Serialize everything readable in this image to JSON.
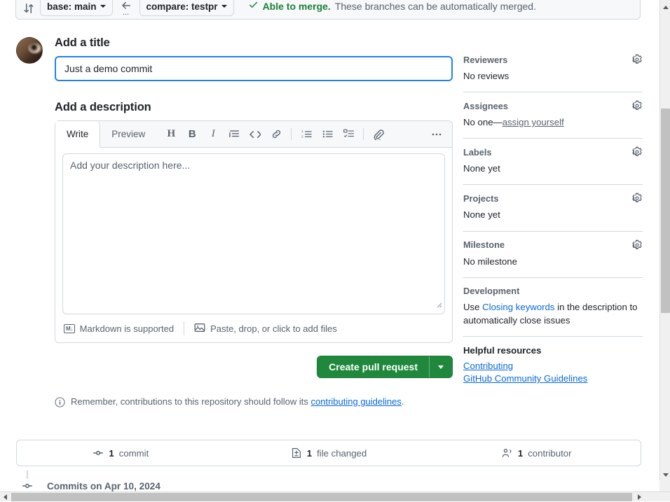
{
  "compare_bar": {
    "compare_icon": "branch-compare-icon",
    "base_label": "base: main",
    "arrow_icon": "arrow-left-icon",
    "arrow_dots": "...",
    "compare_label": "compare: testpr",
    "check_icon": "check-icon",
    "merge_status_strong": "Able to merge.",
    "merge_status_rest": "These branches can be automatically merged."
  },
  "form": {
    "title_heading": "Add a title",
    "title_value": "Just a demo commit",
    "title_placeholder": "Title",
    "description_heading": "Add a description",
    "description_value": "",
    "description_placeholder": "Add your description here...",
    "tabs": [
      {
        "label": "Write",
        "name": "tab-write"
      },
      {
        "label": "Preview",
        "name": "tab-preview"
      }
    ],
    "tools": [
      {
        "name": "heading-icon",
        "glyph": "H"
      },
      {
        "name": "bold-icon",
        "glyph": "B"
      },
      {
        "name": "italic-icon",
        "glyph": "I"
      },
      {
        "name": "quote-icon",
        "glyph": ""
      },
      {
        "name": "code-icon",
        "glyph": "<>"
      },
      {
        "name": "link-icon",
        "glyph": ""
      },
      {
        "name": "ordered-list-icon",
        "glyph": ""
      },
      {
        "name": "unordered-list-icon",
        "glyph": ""
      },
      {
        "name": "task-list-icon",
        "glyph": ""
      },
      {
        "name": "attach-file-icon",
        "glyph": ""
      },
      {
        "name": "more-options-icon",
        "glyph": "…"
      }
    ],
    "footer": {
      "markdown_badge": "M↓",
      "markdown_text": "Markdown is supported",
      "attach_icon": "image-icon",
      "attach_text": "Paste, drop, or click to add files"
    },
    "submit_label": "Create pull request",
    "submit_dropdown_icon": "chevron-down-icon",
    "note_icon": "info-icon",
    "note_text_before": "Remember, contributions to this repository should follow its ",
    "note_link": "contributing guidelines",
    "note_text_after": "."
  },
  "sidebar": {
    "sections": [
      {
        "title": "Reviewers",
        "body": "No reviews",
        "gear": "gear-icon"
      },
      {
        "title": "Assignees",
        "body_prefix": "No one—",
        "body_link": "assign yourself",
        "gear": "gear-icon"
      },
      {
        "title": "Labels",
        "body": "None yet",
        "gear": "gear-icon"
      },
      {
        "title": "Projects",
        "body": "None yet",
        "gear": "gear-icon"
      },
      {
        "title": "Milestone",
        "body": "No milestone",
        "gear": "gear-icon"
      }
    ],
    "development": {
      "title": "Development",
      "text_before": "Use ",
      "link": "Closing keywords",
      "text_after": " in the description to automatically close issues"
    },
    "resources": {
      "title": "Helpful resources",
      "links": [
        "Contributing",
        "GitHub Community Guidelines"
      ]
    }
  },
  "stats": [
    {
      "icon": "commit-icon",
      "count": "1",
      "label": "commit"
    },
    {
      "icon": "file-diff-icon",
      "count": "1",
      "label": "file changed"
    },
    {
      "icon": "people-icon",
      "count": "1",
      "label": "contributor"
    }
  ],
  "timeline": {
    "commit_icon": "commit-icon",
    "label": "Commits on Apr 10, 2024"
  },
  "colors": {
    "accent_blue": "#0969da",
    "focus_blue": "#2383e2",
    "success_green": "#1a7f37",
    "button_green": "#1f883d",
    "muted": "#59636e",
    "border": "#d1d9e0"
  }
}
